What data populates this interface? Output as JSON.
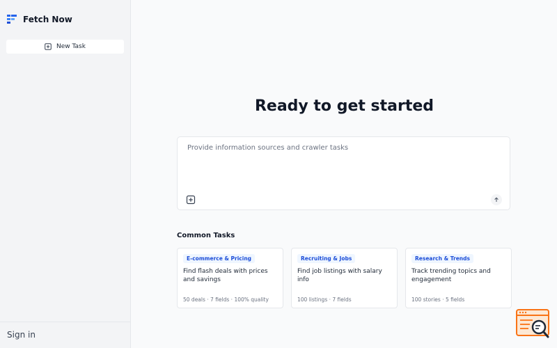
{
  "app": {
    "name": "Fetch Now"
  },
  "sidebar": {
    "new_task_label": "New Task",
    "sign_in_label": "Sign in"
  },
  "main": {
    "heading": "Ready to get started",
    "composer": {
      "placeholder": "Provide information sources and crawler tasks",
      "value": ""
    },
    "section_title": "Common Tasks",
    "cards": [
      {
        "tag": "E-commerce & Pricing",
        "title": "Find flash deals with prices and savings",
        "meta": "50 deals · 7 fields · 100% quality"
      },
      {
        "tag": "Recruiting & Jobs",
        "title": "Find job listings with salary info",
        "meta": "100 listings · 7 fields"
      },
      {
        "tag": "Research & Trends",
        "title": "Track trending topics and engagement",
        "meta": "100 stories · 5 fields"
      }
    ]
  },
  "icons": {
    "logo": "fetch-now-logo-icon",
    "new_task": "plus-square-icon",
    "attach": "plus-square-icon",
    "send": "arrow-up-icon",
    "corner": "browser-search-icon"
  },
  "colors": {
    "accent": "#1d4ed8",
    "tag_bg": "#eff6ff",
    "badge": "#f97316",
    "badge_bg": "#fde8d4"
  }
}
